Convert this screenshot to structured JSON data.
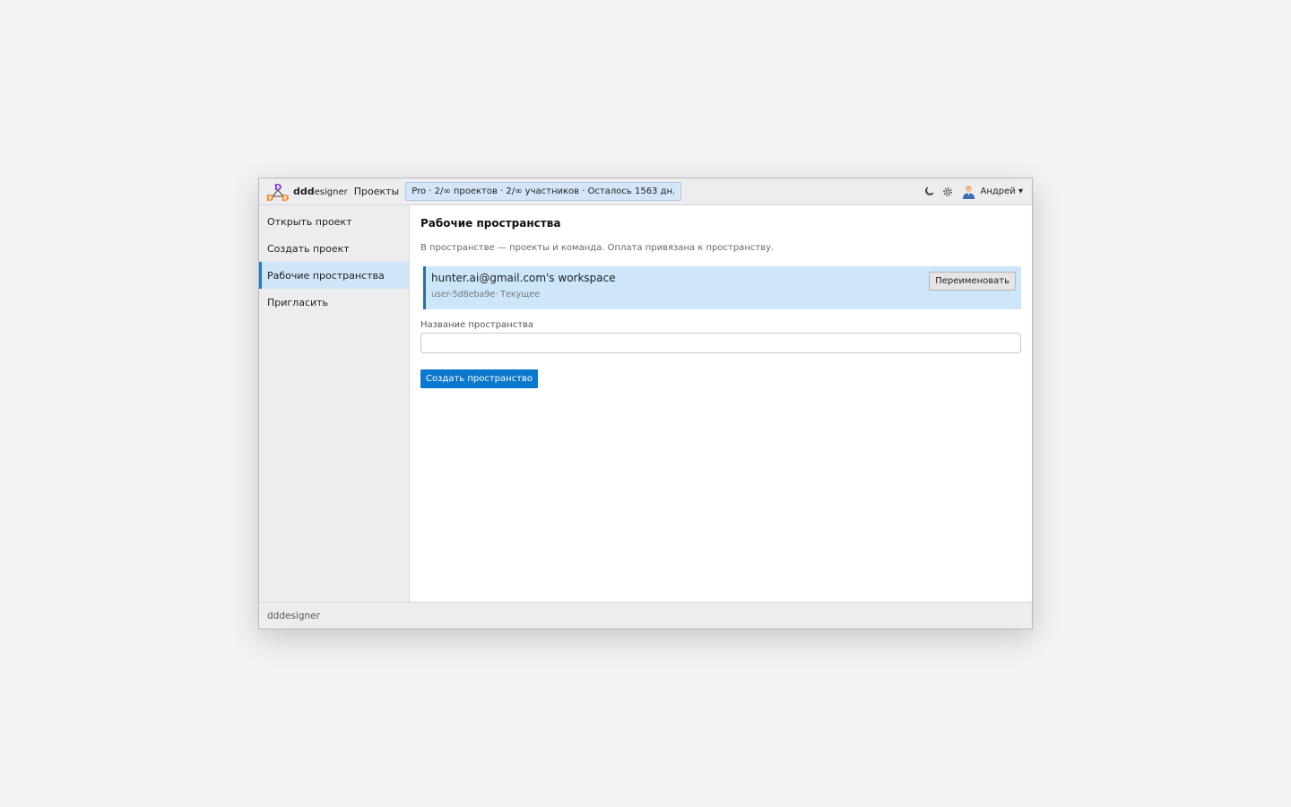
{
  "header": {
    "brand_bold": "ddd",
    "brand_rest": "esigner",
    "projects_label": "Проекты",
    "plan_badge": "Pro · 2/∞ проектов · 2/∞ участников · Осталось 1563 дн.",
    "theme_icon": "moon-icon",
    "settings_icon": "gear-icon",
    "user_name": "Андрей ▾"
  },
  "sidebar": {
    "items": [
      {
        "label": "Открыть проект"
      },
      {
        "label": "Создать проект"
      },
      {
        "label": "Рабочие пространства"
      },
      {
        "label": "Пригласить"
      }
    ],
    "active_index": 2
  },
  "main": {
    "title": "Рабочие пространства",
    "subtitle": "В пространстве — проекты и команда. Оплата привязана к пространству.",
    "workspace": {
      "name": "hunter.ai@gmail.com's workspace",
      "meta": "user-5d8eba9e· Текущее",
      "rename_label": "Переименовать"
    },
    "field_label": "Название пространства",
    "field_value": "",
    "field_placeholder": "",
    "create_label": "Создать пространство"
  },
  "footer": {
    "text": "dddesigner"
  },
  "colors": {
    "accent": "#0b78cf",
    "active_bg": "#cfe5f8",
    "card_bg": "#cde6fa",
    "logo_orange": "#f08a1c",
    "logo_purple": "#7b3fd1"
  }
}
